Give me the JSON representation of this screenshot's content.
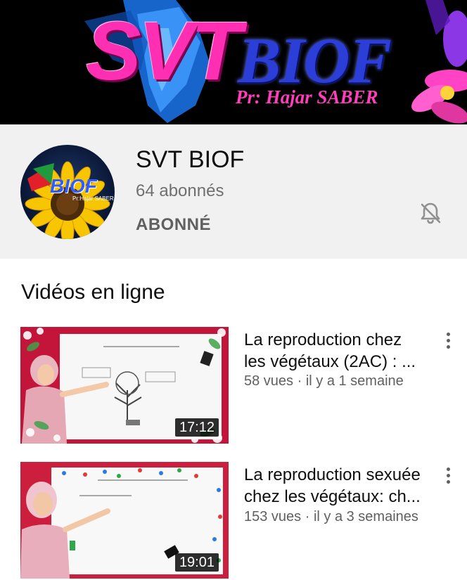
{
  "banner": {
    "title_part1": "SVT",
    "title_part2": "BIOF",
    "author": "Pr: Hajar SABER"
  },
  "channel": {
    "name": "SVT BIOF",
    "subscribers": "64 abonnés",
    "subscribe_state": "ABONNÉ",
    "avatar_text": "BIOF",
    "avatar_author": "Pr:Hajar SABER",
    "notification_icon": "bell-off-icon"
  },
  "section": {
    "title": "Vidéos en ligne"
  },
  "videos": [
    {
      "title_line1": "La reproduction chez",
      "title_line2": "les végétaux (2AC) : ...",
      "meta": "58 vues · il y a 1 semaine",
      "duration": "17:12"
    },
    {
      "title_line1": "La reproduction sexuée",
      "title_line2": "chez les végétaux: ch...",
      "meta": "153 vues · il y a 3 semaines",
      "duration": "19:01"
    }
  ],
  "colors": {
    "banner_pink": "#ff2fb3",
    "banner_blue": "#2b3fd8",
    "header_bg": "#f1f1f1",
    "meta_gray": "#606060"
  }
}
